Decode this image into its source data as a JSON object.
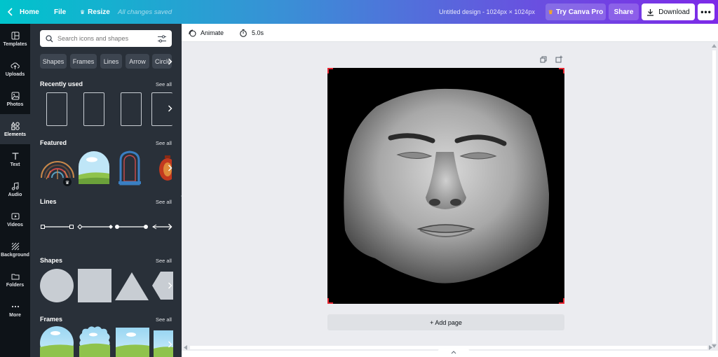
{
  "topbar": {
    "home_label": "Home",
    "file_label": "File",
    "resize_label": "Resize",
    "save_status": "All changes saved",
    "doc_title": "Untitled design - 1024px × 1024px",
    "try_pro_label": "Try Canva Pro",
    "share_label": "Share",
    "download_label": "Download",
    "more_label": "•••"
  },
  "rail": {
    "items": [
      {
        "label": "Templates",
        "icon": "templates-icon"
      },
      {
        "label": "Uploads",
        "icon": "upload-cloud-icon"
      },
      {
        "label": "Photos",
        "icon": "image-icon"
      },
      {
        "label": "Elements",
        "icon": "elements-shapes-icon"
      },
      {
        "label": "Text",
        "icon": "text-t-icon"
      },
      {
        "label": "Audio",
        "icon": "music-note-icon"
      },
      {
        "label": "Videos",
        "icon": "video-icon"
      },
      {
        "label": "Background",
        "icon": "hatch-pattern-icon"
      },
      {
        "label": "Folders",
        "icon": "folder-icon"
      },
      {
        "label": "More",
        "icon": "more-dots-icon"
      }
    ],
    "active_index": 3
  },
  "panel": {
    "search_placeholder": "Search icons and shapes",
    "chips": [
      "Shapes",
      "Frames",
      "Lines",
      "Arrow",
      "Circle"
    ],
    "sections": {
      "recently_used": "Recently used",
      "featured": "Featured",
      "lines": "Lines",
      "shapes": "Shapes",
      "frames": "Frames"
    },
    "see_all": "See all"
  },
  "canvas": {
    "animate_label": "Animate",
    "duration_label": "5.0s",
    "add_page_label": "+ Add page"
  },
  "colors": {
    "accent_red": "#e5242f",
    "panel_bg": "#293039",
    "rail_bg": "#0e1318",
    "crown": "#f5a623"
  }
}
